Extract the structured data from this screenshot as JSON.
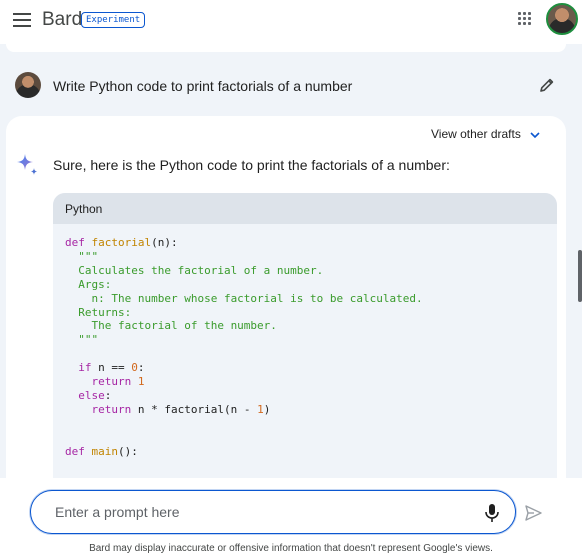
{
  "header": {
    "brand": "Bard",
    "badge": "Experiment",
    "menu_icon": "hamburger-menu-icon",
    "apps_icon": "apps-grid-icon",
    "avatar": "user-avatar"
  },
  "conversation": {
    "user_prompt": "Write Python code to print factorials of a number",
    "edit_icon": "pencil-icon",
    "drafts_label": "View other drafts",
    "drafts_icon": "chevron-down-icon",
    "assistant_icon": "sparkle-icon",
    "response_text": "Sure, here is the Python code to print the factorials of a number:",
    "code": {
      "language": "Python",
      "lines": [
        "def factorial(n):",
        "  \"\"\"",
        "  Calculates the factorial of a number.",
        "",
        "  Args:",
        "    n: The number whose factorial is to be calculated.",
        "",
        "  Returns:",
        "    The factorial of the number.",
        "  \"\"\"",
        "",
        "  if n == 0:",
        "    return 1",
        "  else:",
        "    return n * factorial(n - 1)",
        "",
        "",
        "def main():"
      ]
    }
  },
  "input": {
    "placeholder": "Enter a prompt here",
    "mic_icon": "microphone-icon",
    "send_icon": "send-icon"
  },
  "footer": {
    "disclaimer": "Bard may display inaccurate or offensive information that doesn't represent Google's views."
  },
  "colors": {
    "accent": "#0b57d0",
    "background": "#f0f4f9",
    "code_header": "#dde3ea",
    "keyword": "#a626a4",
    "function": "#c18401",
    "string": "#3a9b2c",
    "number": "#d2691e"
  }
}
